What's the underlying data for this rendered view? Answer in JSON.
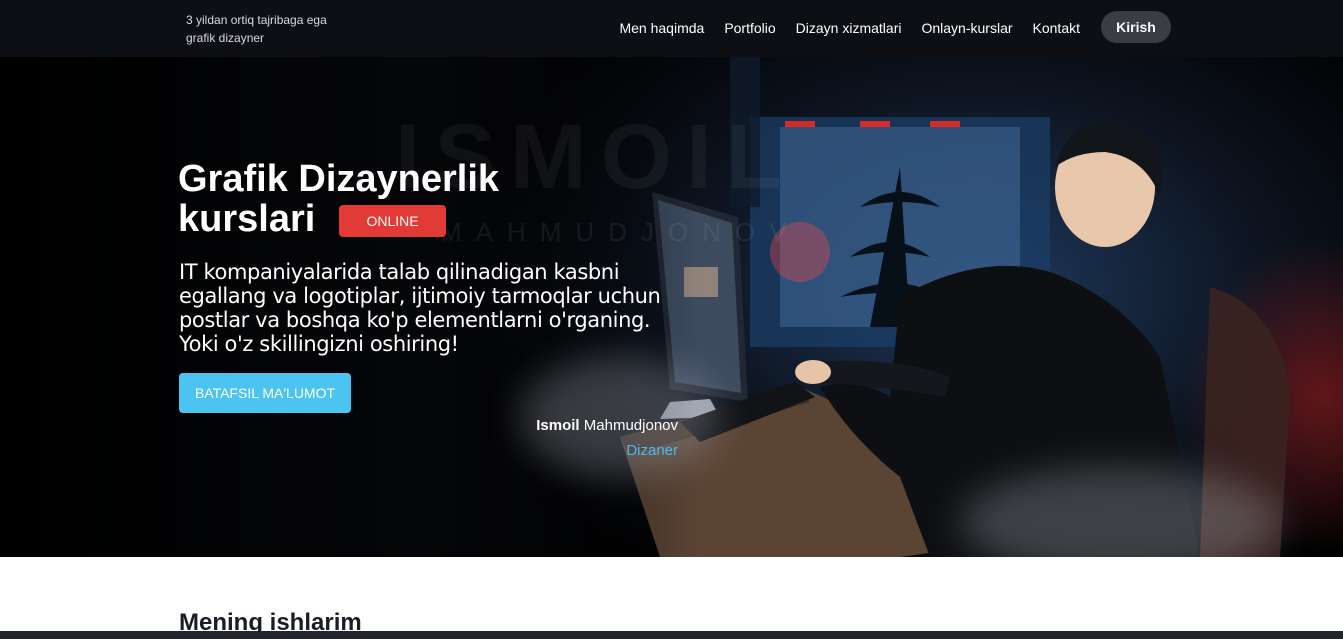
{
  "header": {
    "tagline_line1": "3 yildan ortiq tajribaga ega",
    "tagline_line2": "grafik dizayner",
    "nav": [
      {
        "label": "Men haqimda"
      },
      {
        "label": "Portfolio"
      },
      {
        "label": "Dizayn xizmatlari"
      },
      {
        "label": "Onlayn-kurslar"
      },
      {
        "label": "Kontakt"
      }
    ],
    "login_label": "Kirish"
  },
  "hero": {
    "title_line1": "Grafik Dizaynerlik",
    "title_line2": "kurslari",
    "badge": "ONLINE",
    "description": "IT kompaniyalarida talab qilinadigan kasbni egallang va logotiplar, ijtimoiy tarmoqlar uchun postlar va boshqa ko'p elementlarni o'rganing. Yoki o'z skillingizni oshiring!",
    "cta_label": "BATAFSIL MA'LUMOT",
    "author_first": "Ismoil",
    "author_last": "Mahmudjonov",
    "author_role": "Dizaner",
    "watermark": "ISMOIL",
    "watermark_sub": "MAHMUDJONOV"
  },
  "works": {
    "title": "Mening ishlarim"
  },
  "colors": {
    "accent_blue": "#4cc4f2",
    "badge_red": "#e23a37",
    "nav_bg": "#0d0f14"
  }
}
